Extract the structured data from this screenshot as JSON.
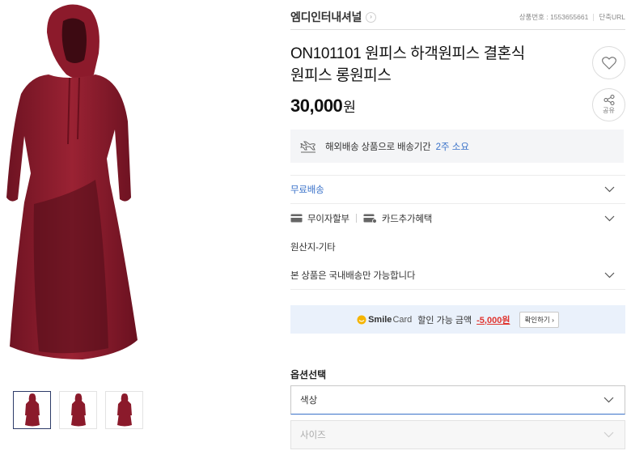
{
  "seller": {
    "name": "엠디인터내셔널",
    "arrow": "›"
  },
  "meta": {
    "product_no": "상품번호 : 1553655661",
    "short_url": "단축URL"
  },
  "product": {
    "title_line1": "ON101101 원피스 하객원피스 결혼식",
    "title_line2": "원피스 롱원피스",
    "price": "30,000",
    "currency": "원"
  },
  "actions": {
    "share_label": "공유"
  },
  "shipping": {
    "overseas_text": "해외배송 상품으로 배송기간",
    "overseas_period": "2주 소요",
    "free_shipping": "무료배송",
    "installment": "무이자할부",
    "card_benefit": "카드추가혜택",
    "origin": "원산지-기타",
    "domestic_only": "본 상품은 국내배송만 가능합니다"
  },
  "smilecard": {
    "logo_main": "Smile",
    "logo_sub": "Card",
    "label": "할인 가능 금액",
    "amount": "-5,000원",
    "button": "확인하기 ›"
  },
  "options": {
    "title": "옵션선택",
    "color_select": "색상",
    "size_select": "사이즈"
  },
  "colors": {
    "accent_blue": "#3a72c9",
    "discount_red": "#e0342f",
    "dress_red": "#8b1a2b"
  }
}
